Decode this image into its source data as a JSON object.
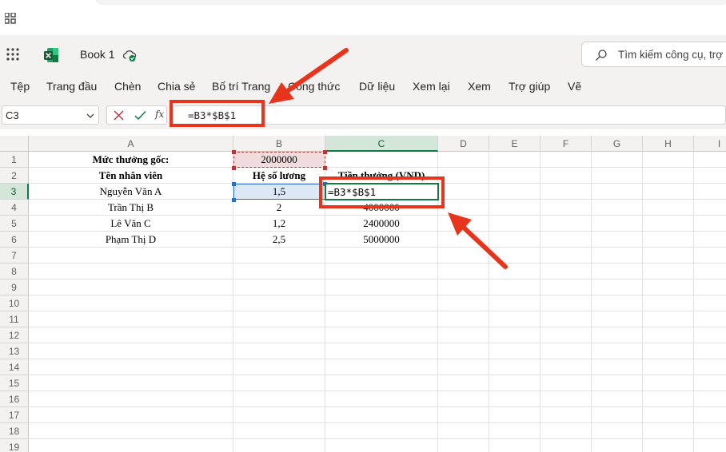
{
  "title_bar": {
    "app_name": "Book 1",
    "search_placeholder": "Tìm kiếm công cụ, trợ"
  },
  "menu": {
    "items": [
      "Tệp",
      "Trang đầu",
      "Chèn",
      "Chia sẻ",
      "Bố trí Trang",
      "Công thức",
      "Dữ liệu",
      "Xem lại",
      "Xem",
      "Trợ giúp",
      "Vẽ"
    ]
  },
  "formula_bar": {
    "name_box": "C3",
    "fx_label": "fx",
    "formula": "=B3*$B$1"
  },
  "sheet": {
    "columns": [
      "A",
      "B",
      "C",
      "D",
      "E",
      "F",
      "G",
      "H",
      "I"
    ],
    "rows": [
      "1",
      "2",
      "3",
      "4",
      "5",
      "6",
      "7",
      "8",
      "9",
      "10",
      "11",
      "12",
      "13",
      "14",
      "15",
      "16",
      "17",
      "18",
      "19"
    ],
    "active_cell": "C3",
    "active_cell_content": "=B3*$B$1",
    "cells": {
      "A1": "Mức thưởng gốc:",
      "B1": "2000000",
      "A2": "Tên nhân viên",
      "B2": "Hệ số lương",
      "C2": "Tiền thưởng (VND)",
      "A3": "Nguyễn Văn A",
      "B3": "1,5",
      "A4": "Trần Thị B",
      "B4": "2",
      "C4": "4000000",
      "A5": "Lê Văn C",
      "B5": "1,2",
      "C5": "2400000",
      "A6": "Phạm Thị D",
      "B6": "2,5",
      "C6": "5000000"
    }
  },
  "colors": {
    "excel_green": "#107c41",
    "annotation_red": "#e8341c",
    "ref_red": "#b03a3a",
    "ref_blue": "#2f6fc0"
  }
}
